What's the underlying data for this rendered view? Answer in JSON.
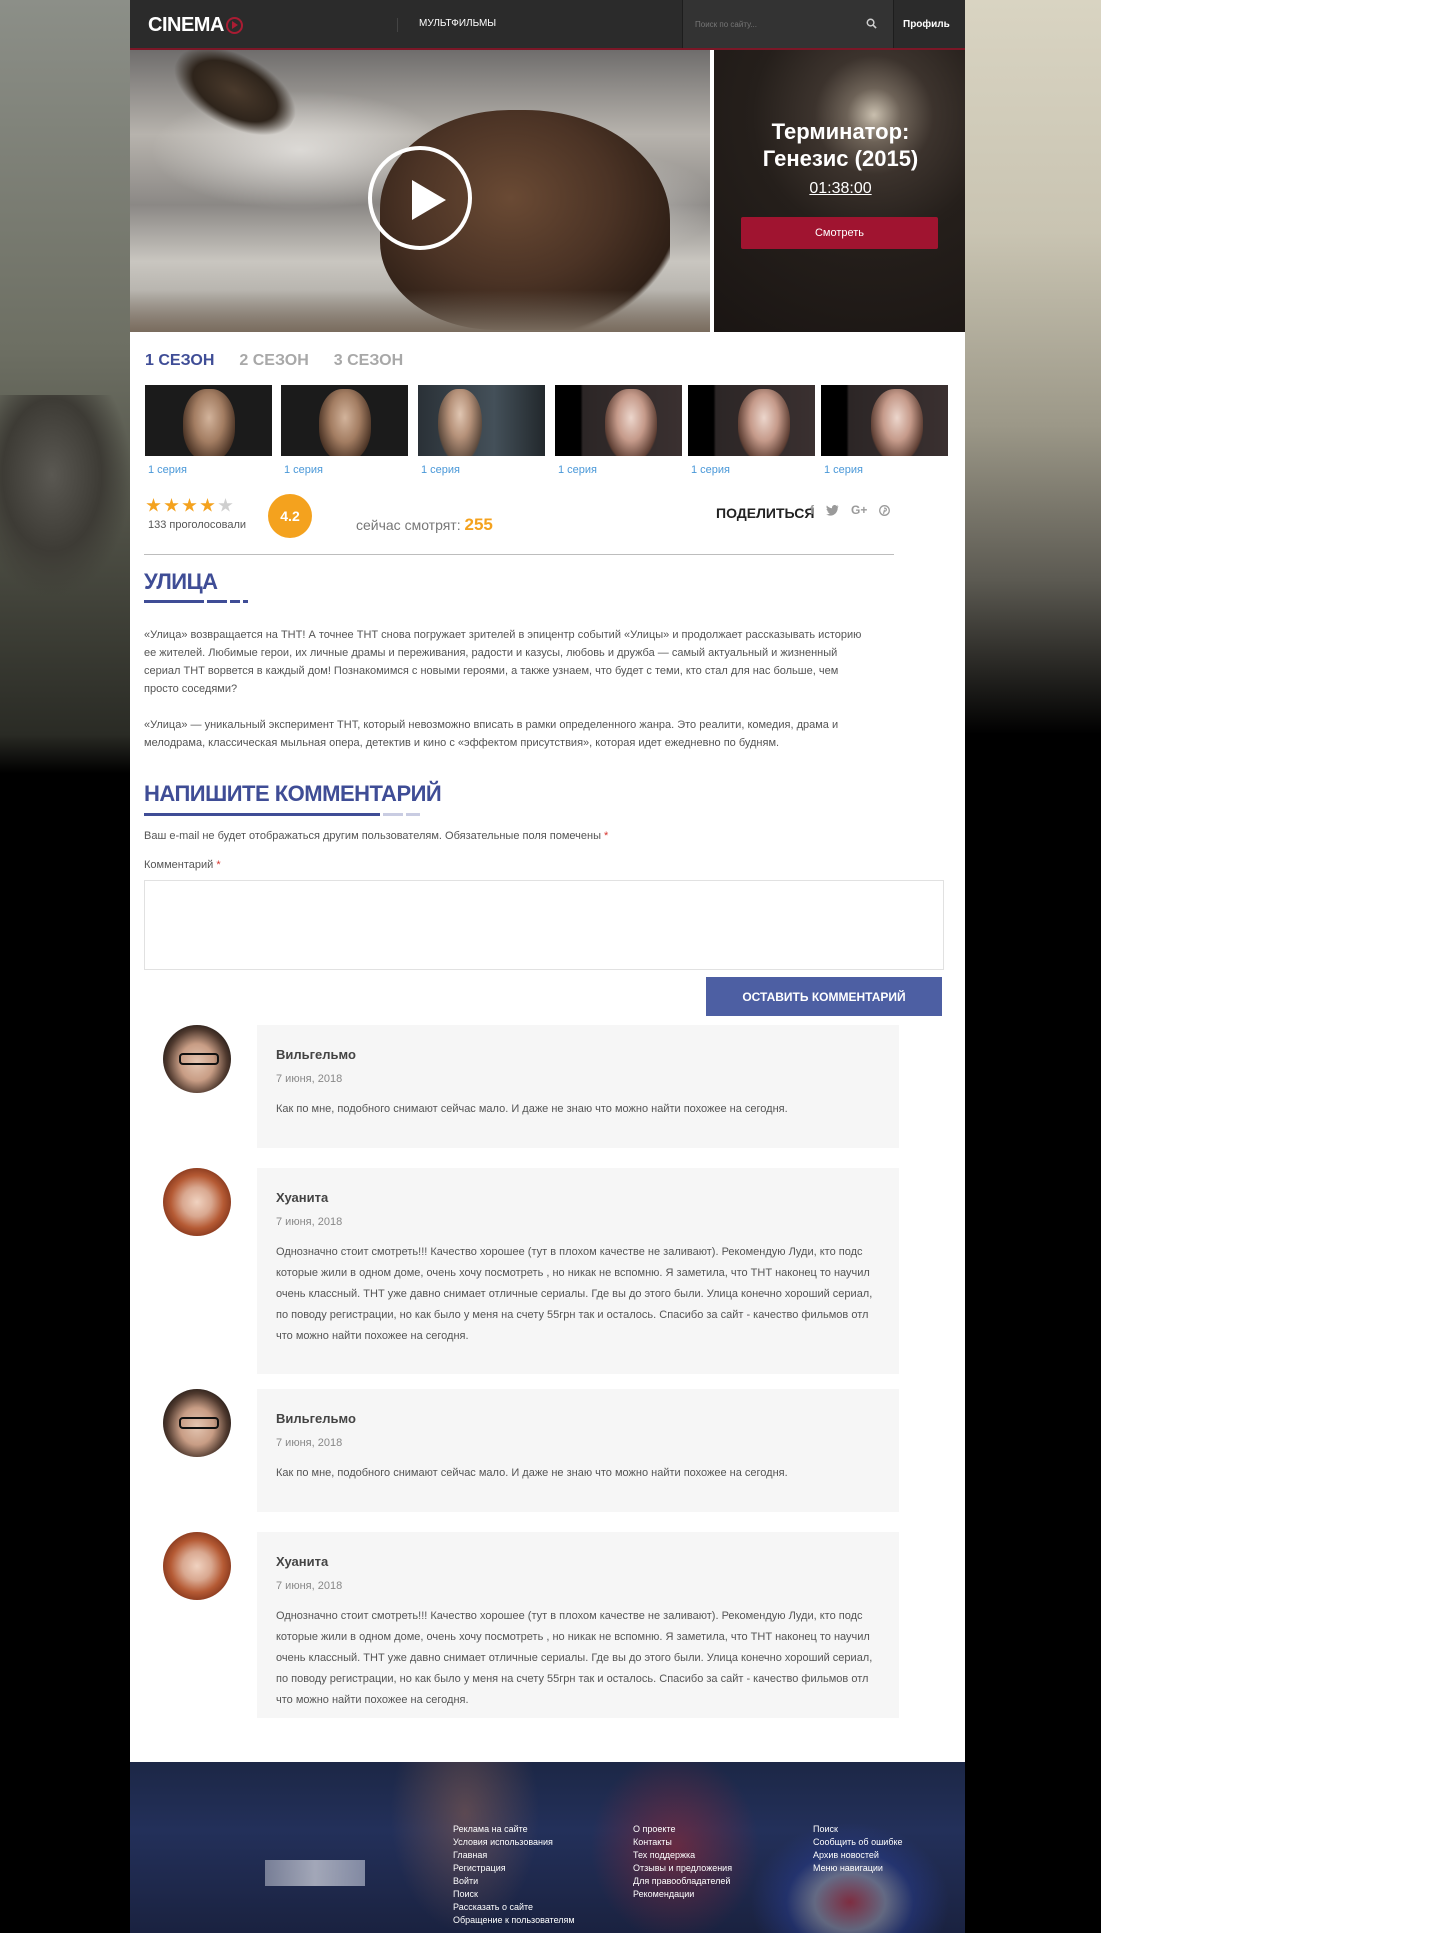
{
  "header": {
    "logo": "CINEMA",
    "nav_link": "МУЛЬТФИЛЬМЫ",
    "search_placeholder": "Поиск по сайту...",
    "profile": "Профиль"
  },
  "hero": {
    "title_line1": "Терминатор:",
    "title_line2": "Генезис (2015)",
    "duration": "01:38:00",
    "watch_button": "Смотреть"
  },
  "seasons": [
    "1 СЕЗОН",
    "2 СЕЗОН",
    "3 СЕЗОН"
  ],
  "episodes": [
    "1 серия",
    "1 серия",
    "1 серия",
    "1 серия",
    "1 серия",
    "1 серия"
  ],
  "rating": {
    "stars": 4,
    "stars_max": 5,
    "votes": "133 проголосовали",
    "score": "4.2",
    "watching_label": "сейчас смотрят:",
    "watching_count": "255",
    "share": "ПОДЕЛИТЬСЯ",
    "share_icons": [
      "facebook-icon",
      "twitter-icon",
      "google-plus-icon",
      "pinterest-icon"
    ]
  },
  "article": {
    "title": "УЛИЦА",
    "paragraph1_lines": [
      "«Улица» возвращается на ТНТ! А точнее ТНТ снова погружает зрителей в эпицентр событий «Улицы» и продолжает рассказывать историю",
      "ее жителей. Любимые герои, их личные драмы и переживания, радости и казусы, любовь и дружба — самый актуальный и жизненный",
      "сериал ТНТ ворвется в каждый дом! Познакомимся с новыми героями, а также узнаем, что будет с теми, кто стал для нас больше, чем",
      "просто соседями?"
    ],
    "paragraph2_lines": [
      "«Улица» — уникальный эксперимент ТНТ, который невозможно вписать в рамки определенного жанра. Это реалити, комедия, драма и",
      "мелодрама, классическая мыльная опера, детектив и кино с «эффектом присутствия», которая идет ежедневно по будням."
    ]
  },
  "comment_form": {
    "title": "НАПИШИТЕ КОММЕНТАРИЙ",
    "note": "Ваш e-mail не будет отображаться другим пользователям. Обязательные поля помечены",
    "asterisk": "*",
    "label": "Комментарий",
    "submit": "ОСТАВИТЬ КОММЕНТАРИЙ"
  },
  "comments": [
    {
      "author": "Вильгельмо",
      "date": "7 июня, 2018",
      "lines": [
        "Как по мне, подобного снимают сейчас мало. И даже не знаю что можно найти похожее на сегодня."
      ]
    },
    {
      "author": "Хуанита",
      "date": "7 июня, 2018",
      "lines": [
        "Однозначно стоит смотреть!!! Качество хорошее (тут в плохом качестве не заливают). Рекомендую Луди, кто подс",
        "которые жили в одном доме, очень хочу посмотреть , но никак не вспомню. Я заметила, что ТНТ наконец то научил",
        "очень классный. ТНТ уже давно снимает отличные сериалы. Где вы до этого были. Улица конечно хороший сериал,",
        "по поводу регистрации, но как было у меня на счету 55грн так и осталось. Спасибо за сайт - качество фильмов отл",
        "что можно найти похожее на сегодня."
      ]
    },
    {
      "author": "Вильгельмо",
      "date": "7 июня, 2018",
      "lines": [
        "Как по мне, подобного снимают сейчас мало. И даже не знаю что можно найти похожее на сегодня."
      ]
    },
    {
      "author": "Хуанита",
      "date": "7 июня, 2018",
      "lines": [
        "Однозначно стоит смотреть!!! Качество хорошее (тут в плохом качестве не заливают). Рекомендую Луди, кто подс",
        "которые жили в одном доме, очень хочу посмотреть , но никак не вспомню. Я заметила, что ТНТ наконец то научил",
        "очень классный. ТНТ уже давно снимает отличные сериалы. Где вы до этого были. Улица конечно хороший сериал,",
        "по поводу регистрации, но как было у меня на счету 55грн так и осталось. Спасибо за сайт - качество фильмов отл",
        "что можно найти похожее на сегодня."
      ]
    }
  ],
  "footer": {
    "col1": [
      "Реклама на сайте",
      "Условия использования",
      "Главная",
      "Регистрация",
      "Войти",
      "Поиск",
      "Рассказать о сайте",
      "Обращение к пользователям"
    ],
    "col2": [
      "О проекте",
      "Контакты",
      "Тех поддержка",
      "Отзывы и предложения",
      "Для правообладателей",
      "Рекомендации"
    ],
    "col3": [
      "Поиск",
      "Сообщить об ошибке",
      "Архив новостей",
      "Меню навигации"
    ]
  },
  "colors": {
    "accent_blue": "#3f4d96",
    "accent_red": "#a01430",
    "rating_orange": "#f4a21e",
    "link_blue": "#4a98d8"
  }
}
